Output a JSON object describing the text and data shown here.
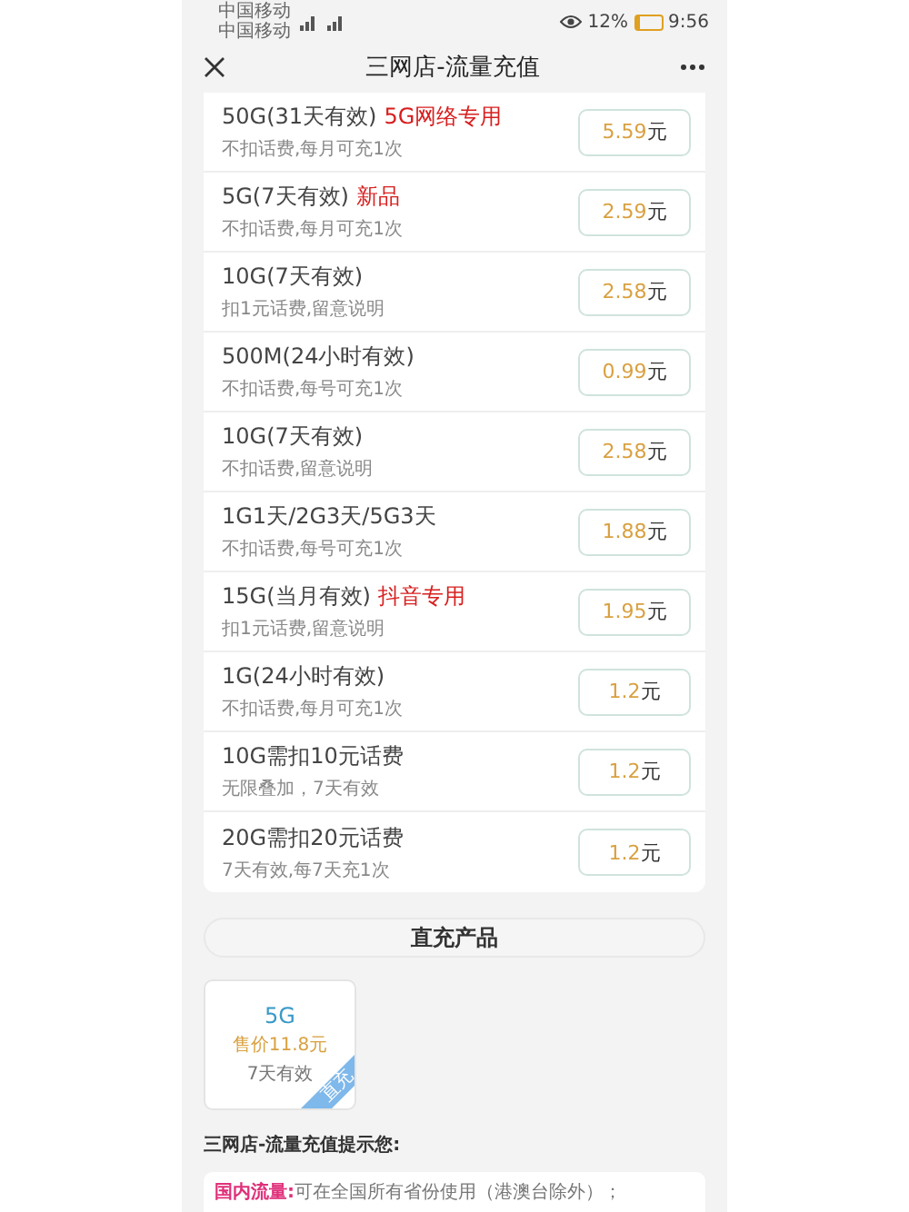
{
  "status_bar": {
    "carriers": [
      "中国移动",
      "中国移动"
    ],
    "battery": "12%",
    "time": "9:56"
  },
  "header": {
    "title": "三网店-流量充值"
  },
  "products": [
    {
      "title": "50G(31天有效)",
      "tag": "5G网络专用",
      "note": "不扣话费,每月可充1次",
      "price": "5.59",
      "unit": "元"
    },
    {
      "title": "5G(7天有效)",
      "tag": "新品",
      "note": "不扣话费,每月可充1次",
      "price": "2.59",
      "unit": "元"
    },
    {
      "title": "10G(7天有效)",
      "note": "扣1元话费,留意说明",
      "price": "2.58",
      "unit": "元"
    },
    {
      "title": "500M(24小时有效)",
      "note": "不扣话费,每号可充1次",
      "price": "0.99",
      "unit": "元"
    },
    {
      "title": "10G(7天有效)",
      "note": "不扣话费,留意说明",
      "price": "2.58",
      "unit": "元"
    },
    {
      "title": "1G1天/2G3天/5G3天",
      "note": "不扣话费,每号可充1次",
      "price": "1.88",
      "unit": "元"
    },
    {
      "title": "15G(当月有效)",
      "tag": "抖音专用",
      "note": "扣1元话费,留意说明",
      "price": "1.95",
      "unit": "元"
    },
    {
      "title": "1G(24小时有效)",
      "note": "不扣话费,每月可充1次",
      "price": "1.2",
      "unit": "元"
    },
    {
      "title": "10G需扣10元话费",
      "note": "无限叠加，7天有效",
      "price": "1.2",
      "unit": "元"
    },
    {
      "title": "20G需扣20元话费",
      "note": "7天有效,每7天充1次",
      "price": "1.2",
      "unit": "元"
    }
  ],
  "section_title": "直充产品",
  "direct_products": [
    {
      "name": "5G",
      "price": "售价11.8元",
      "validity": "7天有效",
      "corner": "直充"
    }
  ],
  "notice_title": "三网店-流量充值提示您:",
  "notice": {
    "label": "国内流量:",
    "text": "可在全国所有省份使用（港澳台除外）；"
  }
}
